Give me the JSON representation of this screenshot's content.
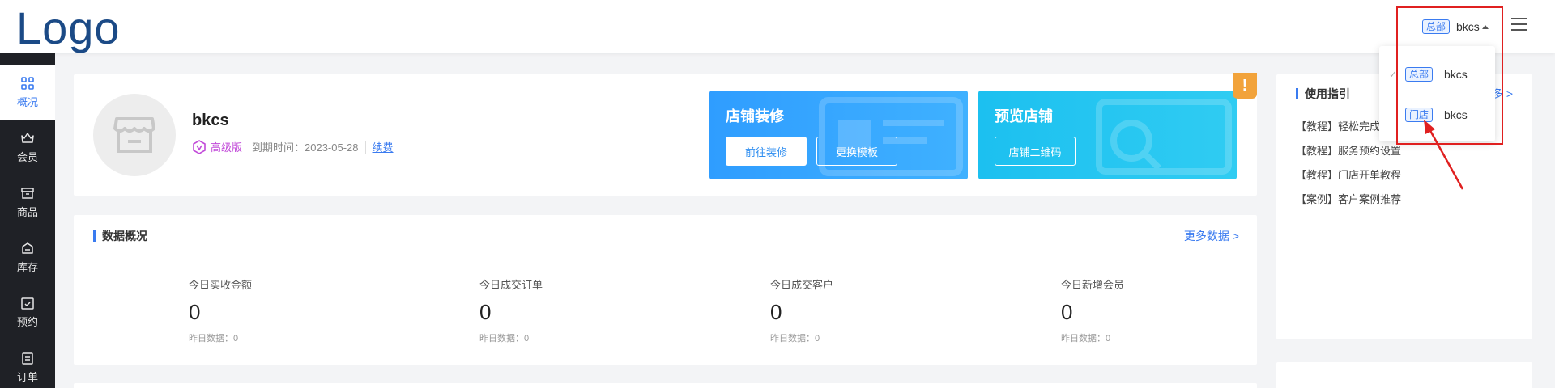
{
  "header": {
    "logo": "Logo",
    "store_tag": "总部",
    "store_name": "bkcs"
  },
  "sidebar": {
    "items": [
      {
        "label": "概况",
        "icon": "grid-icon",
        "active": true
      },
      {
        "label": "会员",
        "icon": "crown-icon",
        "active": false
      },
      {
        "label": "商品",
        "icon": "box-icon",
        "active": false
      },
      {
        "label": "库存",
        "icon": "inventory-icon",
        "active": false
      },
      {
        "label": "预约",
        "icon": "calendar-check-icon",
        "active": false
      },
      {
        "label": "订单",
        "icon": "clipboard-icon",
        "active": false
      }
    ]
  },
  "profile": {
    "shop_name": "bkcs",
    "level": "高级版",
    "expire": "到期时间：2023-05-28",
    "renew": "续费"
  },
  "promo": {
    "decorate_title": "店铺装修",
    "decorate_btn": "前往装修",
    "template_btn": "更换模板",
    "preview_title": "预览店铺",
    "qrcode_btn": "店铺二维码"
  },
  "alert_badge": "!",
  "data_overview": {
    "title": "数据概况",
    "more": "更多数据 >",
    "stats": [
      {
        "label": "今日实收金额",
        "value": "0",
        "yesterday": "昨日数据：0"
      },
      {
        "label": "今日成交订单",
        "value": "0",
        "yesterday": "昨日数据：0"
      },
      {
        "label": "今日成交客户",
        "value": "0",
        "yesterday": "昨日数据：0"
      },
      {
        "label": "今日新增会员",
        "value": "0",
        "yesterday": "昨日数据：0"
      }
    ]
  },
  "guide": {
    "title": "使用指引",
    "more": "多 >",
    "items": [
      "【教程】轻松完成",
      "【教程】服务预约设置",
      "【教程】门店开单教程",
      "【案例】客户案例推荐"
    ]
  },
  "dropdown": {
    "items": [
      {
        "tag": "总部",
        "name": "bkcs",
        "check": "✓"
      },
      {
        "tag": "门店",
        "name": "bkcs",
        "check": ""
      }
    ]
  },
  "colors": {
    "accent": "#3a7bf0",
    "sidebar_bg": "#1f2126",
    "logo": "#1b4a86",
    "annotation": "#e02020",
    "badge": "#f2a33b"
  }
}
